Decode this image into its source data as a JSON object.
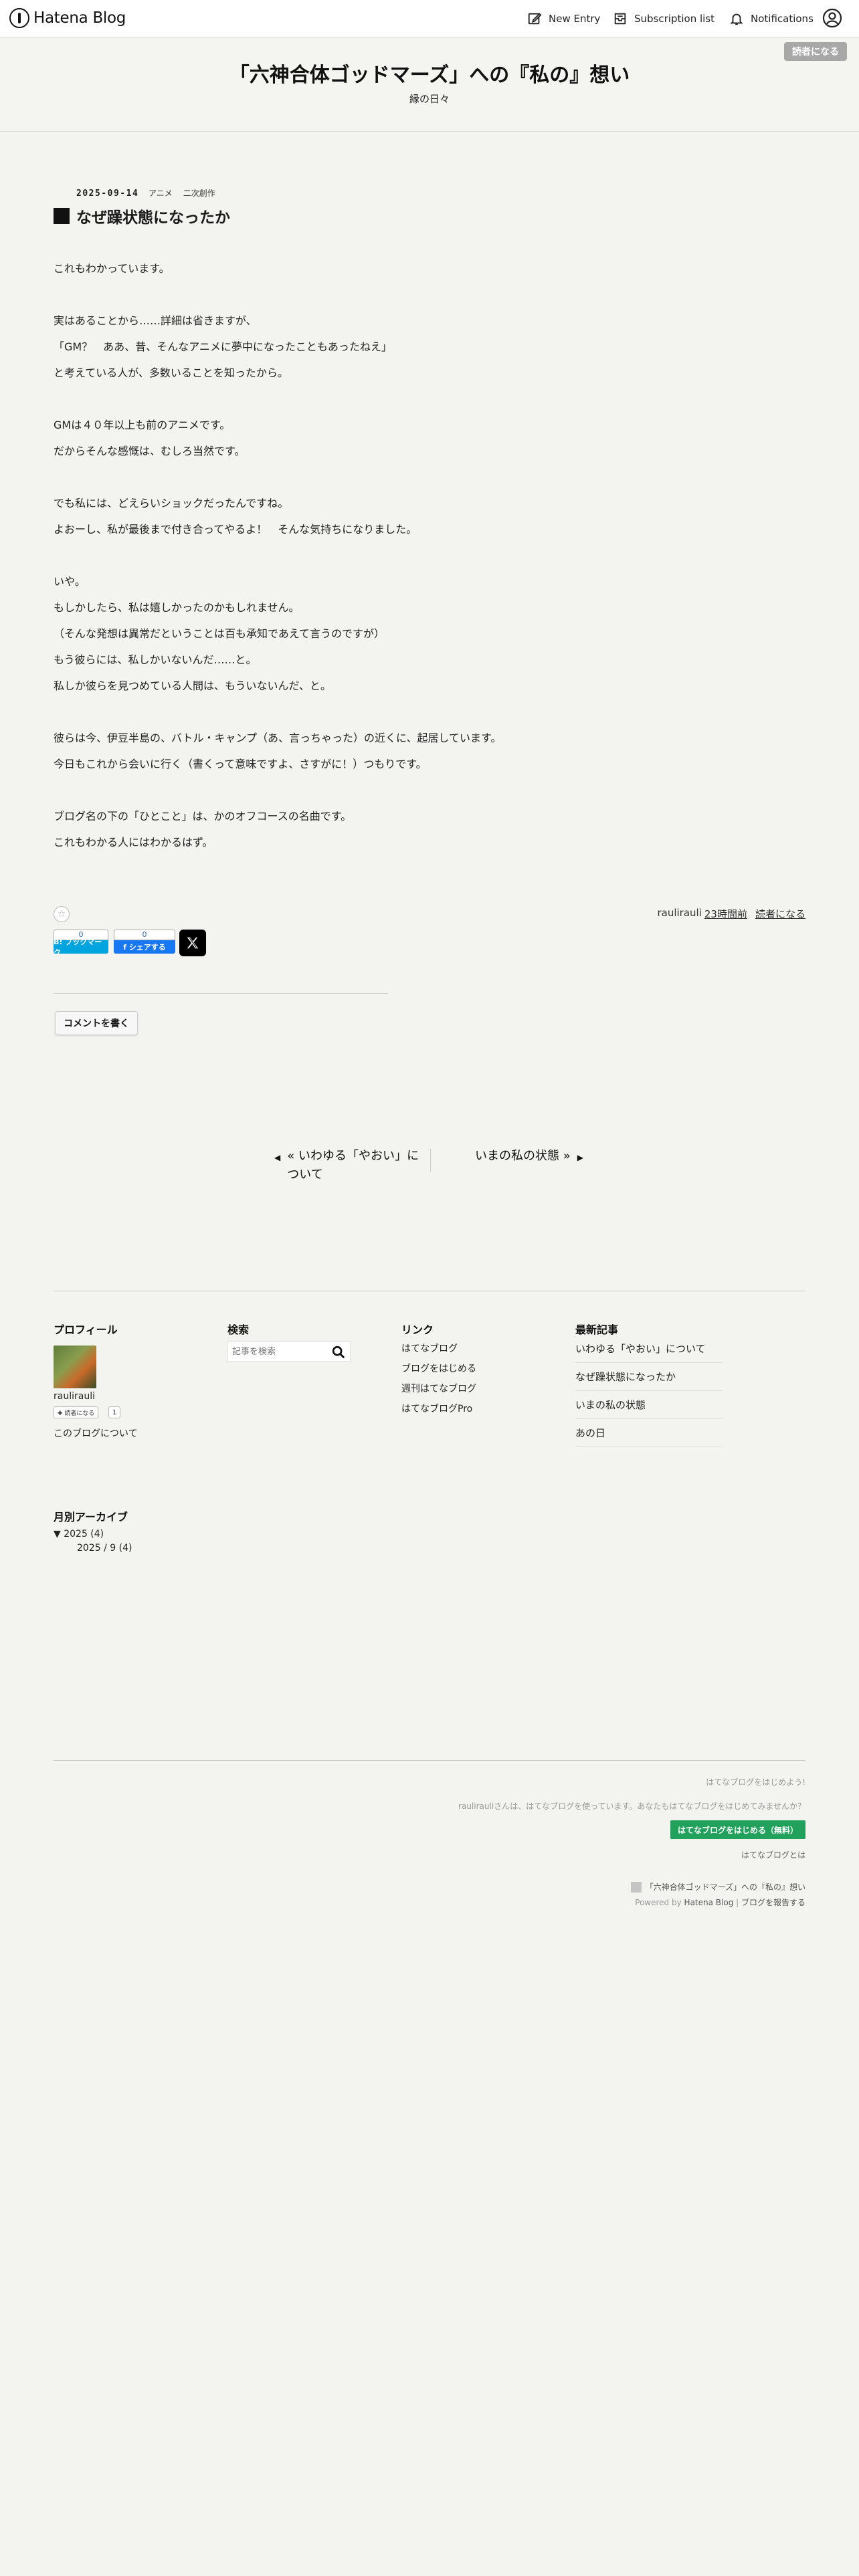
{
  "navbar": {
    "logo_text": "Hatena Blog",
    "new_entry": "New Entry",
    "subscription_list": "Subscription list",
    "notifications": "Notifications"
  },
  "header": {
    "subscribe_button": "読者になる",
    "title": "「六神合体ゴッドマーズ」への『私の』想い",
    "description": "縁の日々"
  },
  "entry": {
    "date": "2025-09-14",
    "categories": [
      "アニメ",
      "二次創作"
    ],
    "title": "なぜ躁状態になったか",
    "lines": [
      "これもわかっています。",
      "",
      "実はあることから……詳細は省きますが、",
      "「GM？　ああ、昔、そんなアニメに夢中になったこともあったねえ」",
      "と考えている人が、多数いることを知ったから。",
      "",
      "GMは４０年以上も前のアニメです。",
      "だからそんな感慨は、むしろ当然です。",
      "",
      "でも私には、どえらいショックだったんですね。",
      "よおーし、私が最後まで付き合ってやるよ！　そんな気持ちになりました。",
      "",
      "いや。",
      "もしかしたら、私は嬉しかったのかもしれません。",
      "（そんな発想は異常だということは百も承知であえて言うのですが）",
      "もう彼らには、私しかいないんだ……と。",
      "私しか彼らを見つめている人間は、もういないんだ、と。",
      "",
      "彼らは今、伊豆半島の、バトル・キャンプ（あ、言っちゃった）の近くに、起居しています。",
      "今日もこれから会いに行く（書くって意味ですよ、さすがに！）つもりです。",
      "",
      "ブログ名の下の「ひとこと」は、かのオフコースの名曲です。",
      "これもわかる人にはわかるはず。"
    ],
    "author": "raulirauli",
    "time_ago": "23時間前",
    "subscribe_link": "読者になる",
    "hatebu_count": "0",
    "hatebu_label": "B! ブックマーク",
    "fb_count": "0",
    "fb_label": "f シェアする",
    "comment_button": "コメントを書く"
  },
  "pager": {
    "prev": "« いわゆる「やおい」について",
    "next": "いまの私の状態 »"
  },
  "sidebar": {
    "profile": {
      "title": "プロフィール",
      "name": "raulirauli",
      "follow": "✚ 読者になる",
      "follow_count": "1",
      "about": "このブログについて"
    },
    "search": {
      "title": "検索",
      "placeholder": "記事を検索"
    },
    "links": {
      "title": "リンク",
      "items": [
        "はてなブログ",
        "ブログをはじめる",
        "週刊はてなブログ",
        "はてなブログPro"
      ]
    },
    "recent": {
      "title": "最新記事",
      "items": [
        "いわゆる「やおい」について",
        "なぜ躁状態になったか",
        "いまの私の状態",
        "あの日"
      ]
    },
    "archive": {
      "title": "月別アーカイブ",
      "year": "▼ 2025 (4)",
      "month": "2025 / 9 (4)"
    }
  },
  "footer": {
    "prompt": "はてなブログをはじめよう!",
    "invite": "raulirauliさんは、はてなブログを使っています。あなたもはてなブログをはじめてみませんか？",
    "start_button": "はてなブログをはじめる（無料）",
    "about": "はてなブログとは",
    "blog_name": "「六神合体ゴッドマーズ」への『私の』想い",
    "powered_prefix": "Powered by",
    "powered_name": "Hatena Blog",
    "report": "ブログを報告する"
  },
  "colors": {
    "background": "#f3f3ef",
    "accent_green": "#21a15b",
    "hatebu_blue": "#00a4de",
    "facebook_blue": "#1877f2"
  }
}
